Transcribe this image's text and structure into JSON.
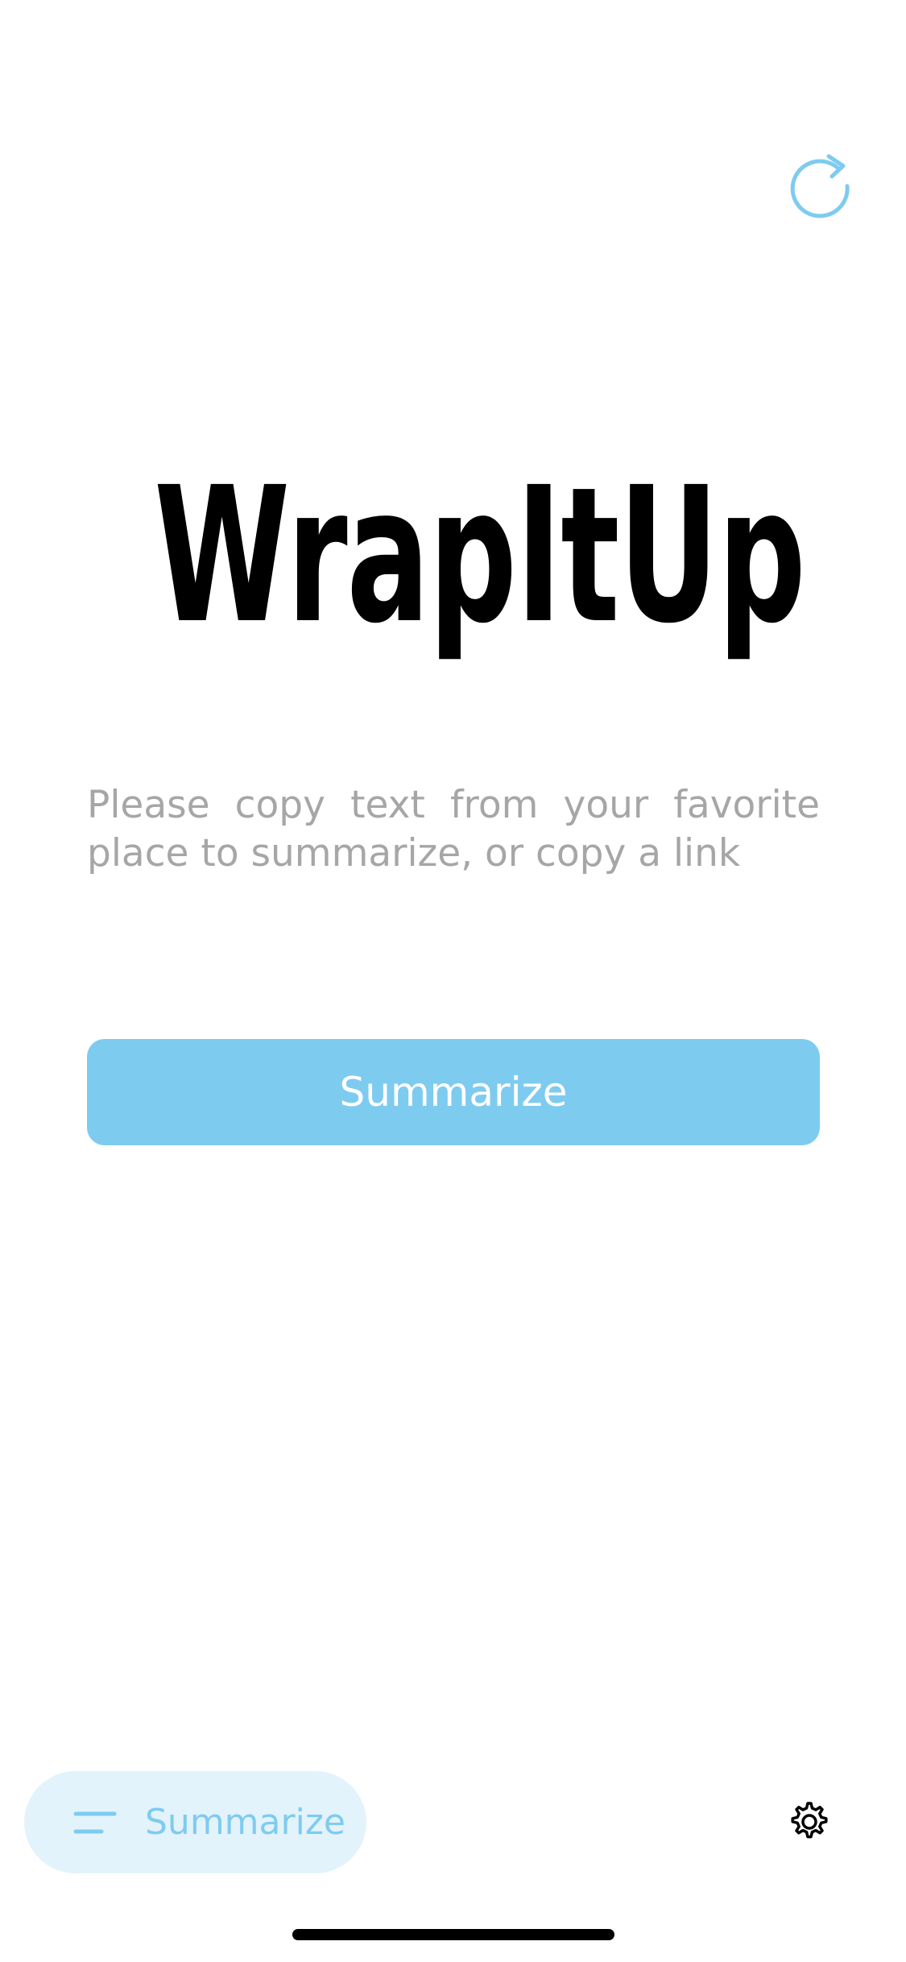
{
  "app": {
    "title": "WrapItUp"
  },
  "main": {
    "instructions": "Please copy text from your favorite place to summarize, or copy a link",
    "summarize_button_label": "Summarize"
  },
  "tab_bar": {
    "active_tab_label": "Summarize",
    "active_tab_icon": "lines-icon",
    "settings_icon": "gear-icon"
  },
  "toolbar": {
    "refresh_icon": "refresh-icon"
  },
  "colors": {
    "accent": "#7ecbf0",
    "accent_light": "#e3f3fb",
    "placeholder_text": "#a6a6a6",
    "title_text": "#000000"
  }
}
